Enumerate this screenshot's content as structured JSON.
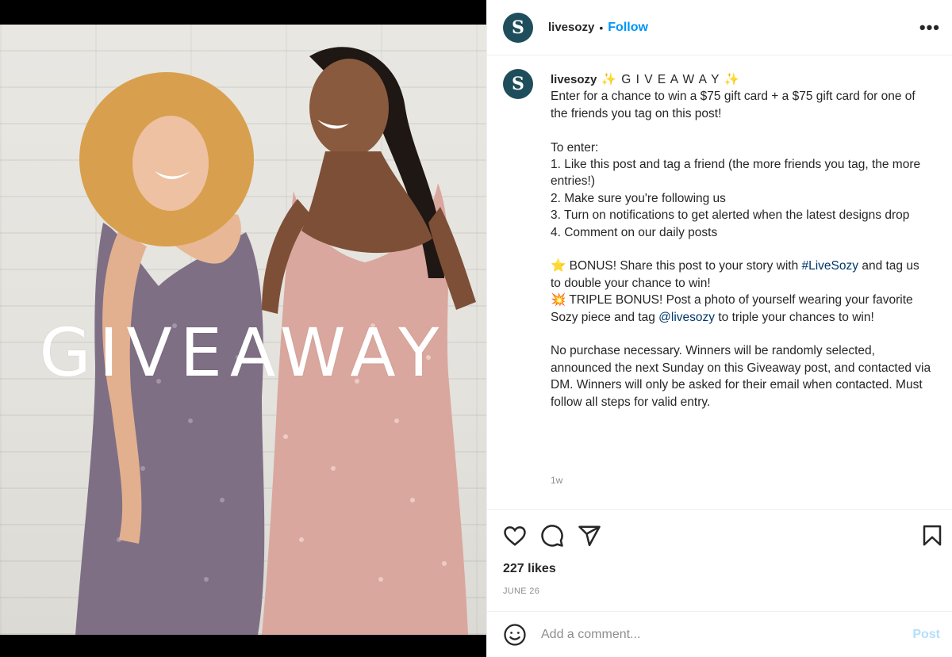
{
  "post": {
    "image_text": "GIVEAWAY",
    "username": "livesozy",
    "avatar_letter": "S",
    "follow_label": "Follow",
    "separator": "•",
    "more_label": "•••",
    "caption": {
      "title": " ✨ G I V E A W A Y ✨",
      "lines": [
        "Enter for a chance to win a $75 gift card + a $75 gift card for one of the friends you tag on this post!",
        "",
        "To enter:",
        "1. Like this post and tag a friend (the more friends you tag, the more entries!)",
        "2. Make sure you're following us",
        "3. Turn on notifications to get alerted when the latest designs drop",
        "4. Comment on our daily posts",
        ""
      ],
      "bonus_prefix": "⭐ BONUS! Share this post to your story with ",
      "bonus_hashtag": "#LiveSozy",
      "bonus_suffix": " and tag us to double your chance to win!",
      "triple_prefix": "💥 TRIPLE BONUS! Post a photo of yourself wearing your favorite Sozy piece and tag ",
      "triple_mention": "@livesozy",
      "triple_suffix": " to triple your chances to win!",
      "disclaimer": "No purchase necessary. Winners will be randomly selected, announced the next Sunday on this Giveaway post, and contacted via DM. Winners will only be asked for their email when contacted. Must follow all steps for valid entry."
    },
    "time_ago": "1w",
    "likes": "227 likes",
    "date": "JUNE 26",
    "comment_placeholder": "Add a comment...",
    "post_label": "Post",
    "icons": [
      "heart-icon",
      "comment-icon",
      "share-icon",
      "bookmark-icon",
      "emoji-icon"
    ],
    "colors": {
      "accent": "#0095f6",
      "avatar_bg": "#1e4e5b",
      "link": "#00376b",
      "post_disabled": "#b2dffc"
    }
  }
}
